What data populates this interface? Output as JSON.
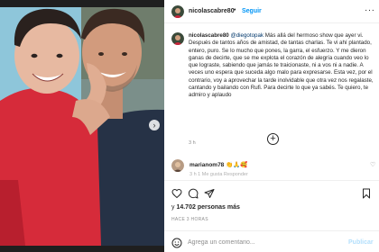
{
  "post": {
    "username": "nicolascabre80",
    "separator": "•",
    "follow_label": "Seguir",
    "more_label": "···"
  },
  "caption": {
    "username": "nicolascabre80",
    "mention": "@diegotopak",
    "text": " Más allá del hermoso show que ayer vi. Después de tantos años de amistad, de tantas charlas. Te vi ahí plantado, entero, puro. Se lo mucho que pones, la garra, el esfuerzo. Y me dieron ganas de decirte, que se me explota el corazón de alegría cuando veo lo que lograste, sabiendo que jamás te traicionaste, ni a vos ni a nadie. A veces uno espera que suceda algo malo para expresarse. Esta vez, por el contrario, voy a aprovechar la tarde inolvidable que otra vez nos regalaste, cantando y bailando con Rufi. Para decirte lo que ya sabés. Te quiero, te admiro y aplaudo",
    "time": "3 h"
  },
  "load_more_label": "+",
  "comment": {
    "username": "marianom78",
    "text": "👏🙏🥰",
    "meta": "3 h   1 Me gusta   Responder",
    "like_icon": "heart-outline-icon"
  },
  "likes": {
    "count": "14.702",
    "suffix": " personas más"
  },
  "time_ago": "HACE 3 HORAS",
  "add_comment": {
    "placeholder": "Agrega un comentario...",
    "publish_label": "Publicar"
  },
  "colors": {
    "accent": "#0095f6",
    "mention": "#00376b",
    "publish_disabled": "#b2dffc",
    "photo_bg": "#1f1f1f",
    "red_shirt": "#d62b3a",
    "sky": "#8ec6da"
  },
  "icons": {
    "carousel_next": "chevron-right-icon",
    "like": "heart-outline-icon",
    "comment": "comment-bubble-icon",
    "share": "paper-plane-icon",
    "save": "bookmark-icon",
    "emoji": "smiley-icon",
    "load_more": "plus-circle-icon"
  }
}
